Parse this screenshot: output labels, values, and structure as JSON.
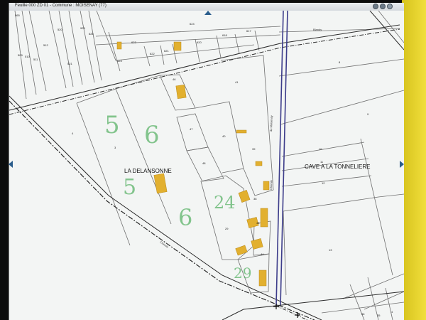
{
  "window": {
    "title": "Feuille 000 ZD 01 - Commune : MOISENAY (77)"
  },
  "colors": {
    "parcel_line": "#6f6f6f",
    "building": "#e2b02f",
    "road": "#2c2c2c",
    "main_road": "#3c3c8a",
    "handwriting": "#5cb36a",
    "background": "#f3f5f4"
  },
  "places": {
    "la_delansonne": "LA DELANSONNE",
    "cave_tonneliere": "CAVE A LA TONNELIERE"
  },
  "roads": {
    "top_right": "Blandy",
    "vertical": "de Moisenay",
    "bottom": "Chemin",
    "diagonal": "Chemin"
  },
  "handwritten": {
    "h1": "5",
    "h2": "6",
    "h3": "5",
    "h4": "6",
    "h5": "24",
    "h6": "29"
  },
  "parcels": {
    "p565": "565",
    "p512": "512",
    "p509": "509",
    "p510": "510",
    "p511": "511",
    "p520": "520",
    "p521": "521",
    "p925": "925",
    "p626": "626",
    "p624": "624",
    "p623": "623",
    "p622": "622",
    "p621": "621",
    "p620": "620",
    "p618": "618",
    "p617": "617",
    "p8": "8",
    "p41": "41",
    "p46": "46",
    "p47": "47",
    "p40": "40",
    "p48": "48",
    "p39": "39",
    "p38": "38",
    "p29": "29",
    "p45": "45",
    "p44": "44",
    "p4": "4",
    "p9": "9",
    "p10": "10",
    "p11": "11",
    "p12": "12",
    "p13": "13",
    "p3": "3",
    "p36": "36",
    "p35": "35",
    "p4b": "4"
  }
}
